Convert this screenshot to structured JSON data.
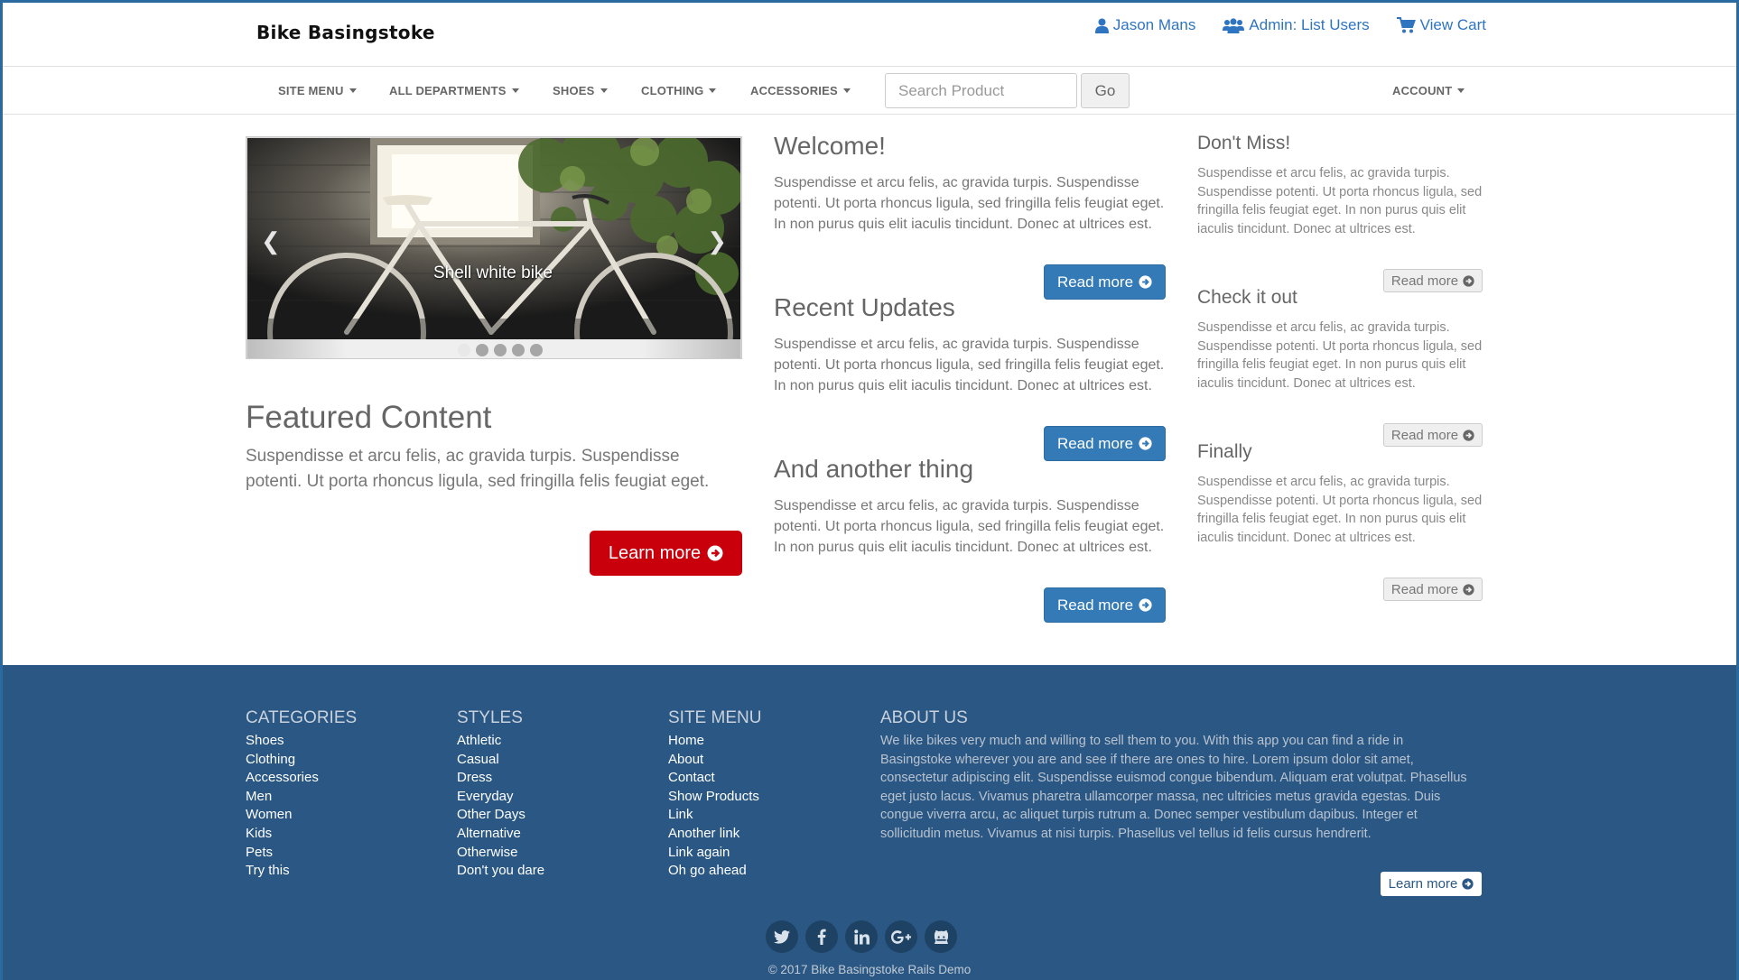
{
  "header": {
    "brand": "Bike Basingstoke",
    "user_link": "Jason Mans",
    "admin_link": "Admin: List Users",
    "cart_link": "View Cart"
  },
  "nav": {
    "items": [
      "SITE MENU",
      "ALL DEPARTMENTS",
      "SHOES",
      "CLOTHING",
      "ACCESSORIES"
    ],
    "search_placeholder": "Search Product",
    "go_label": "Go",
    "account_label": "ACCOUNT"
  },
  "carousel": {
    "caption": "Shell white bike",
    "slide_count": 5,
    "active_index": 0
  },
  "featured": {
    "title": "Featured Content",
    "body": "Suspendisse et arcu felis, ac gravida turpis. Suspendisse potenti. Ut porta rhoncus ligula, sed fringilla felis feugiat eget.",
    "button": "Learn more"
  },
  "middle": [
    {
      "title": "Welcome!",
      "body": "Suspendisse et arcu felis, ac gravida turpis. Suspendisse potenti. Ut porta rhoncus ligula, sed fringilla felis feugiat eget. In non purus quis elit iaculis tincidunt. Donec at ultrices est.",
      "button": "Read more"
    },
    {
      "title": "Recent Updates",
      "body": "Suspendisse et arcu felis, ac gravida turpis. Suspendisse potenti. Ut porta rhoncus ligula, sed fringilla felis feugiat eget. In non purus quis elit iaculis tincidunt. Donec at ultrices est.",
      "button": "Read more"
    },
    {
      "title": "And another thing",
      "body": "Suspendisse et arcu felis, ac gravida turpis. Suspendisse potenti. Ut porta rhoncus ligula, sed fringilla felis feugiat eget. In non purus quis elit iaculis tincidunt. Donec at ultrices est.",
      "button": "Read more"
    }
  ],
  "side": [
    {
      "title": "Don't Miss!",
      "body": "Suspendisse et arcu felis, ac gravida turpis. Suspendisse potenti. Ut porta rhoncus ligula, sed fringilla felis feugiat eget. In non purus quis elit iaculis tincidunt. Donec at ultrices est.",
      "button": "Read more"
    },
    {
      "title": "Check it out",
      "body": "Suspendisse et arcu felis, ac gravida turpis. Suspendisse potenti. Ut porta rhoncus ligula, sed fringilla felis feugiat eget. In non purus quis elit iaculis tincidunt. Donec at ultrices est.",
      "button": "Read more"
    },
    {
      "title": "Finally",
      "body": "Suspendisse et arcu felis, ac gravida turpis. Suspendisse potenti. Ut porta rhoncus ligula, sed fringilla felis feugiat eget. In non purus quis elit iaculis tincidunt. Donec at ultrices est.",
      "button": "Read more"
    }
  ],
  "footer": {
    "categories": {
      "heading": "CATEGORIES",
      "links": [
        "Shoes",
        "Clothing",
        "Accessories",
        "Men",
        "Women",
        "Kids",
        "Pets",
        "Try this"
      ]
    },
    "styles": {
      "heading": "STYLES",
      "links": [
        "Athletic",
        "Casual",
        "Dress",
        "Everyday",
        "Other Days",
        "Alternative",
        "Otherwise",
        "Don't you dare"
      ]
    },
    "site_menu": {
      "heading": "SITE MENU",
      "links": [
        "Home",
        "About",
        "Contact",
        "Show Products",
        "Link",
        "Another link",
        "Link again",
        "Oh go ahead"
      ]
    },
    "about": {
      "heading": "ABOUT US",
      "body": "We like bikes very much and willing to sell them to you. With this app you can find a ride in Basingstoke wherever you are and see if there are ones to hire. Lorem ipsum dolor sit amet, consectetur adipiscing elit. Suspendisse euismod congue bibendum. Aliquam erat volutpat. Phasellus eget justo lacus. Vivamus pharetra ullamcorper massa, nec ultricies metus gravida egestas. Duis congue viverra arcu, ac aliquet turpis rutrum a. Donec semper vestibulum dapibus. Integer et sollicitudin metus. Vivamus at nisi turpis. Phasellus vel tellus id felis cursus hendrerit.",
      "button": "Learn more"
    },
    "socials": [
      "twitter-icon",
      "facebook-icon",
      "linkedin-icon",
      "google-plus-icon",
      "github-icon"
    ],
    "copyright": "© 2017 Bike Basingstoke Rails Demo"
  },
  "colors": {
    "link": "#2f74c0",
    "primary_button": "#337ab7",
    "learn_button": "#c9000b",
    "footer_bg": "#2a5783"
  }
}
